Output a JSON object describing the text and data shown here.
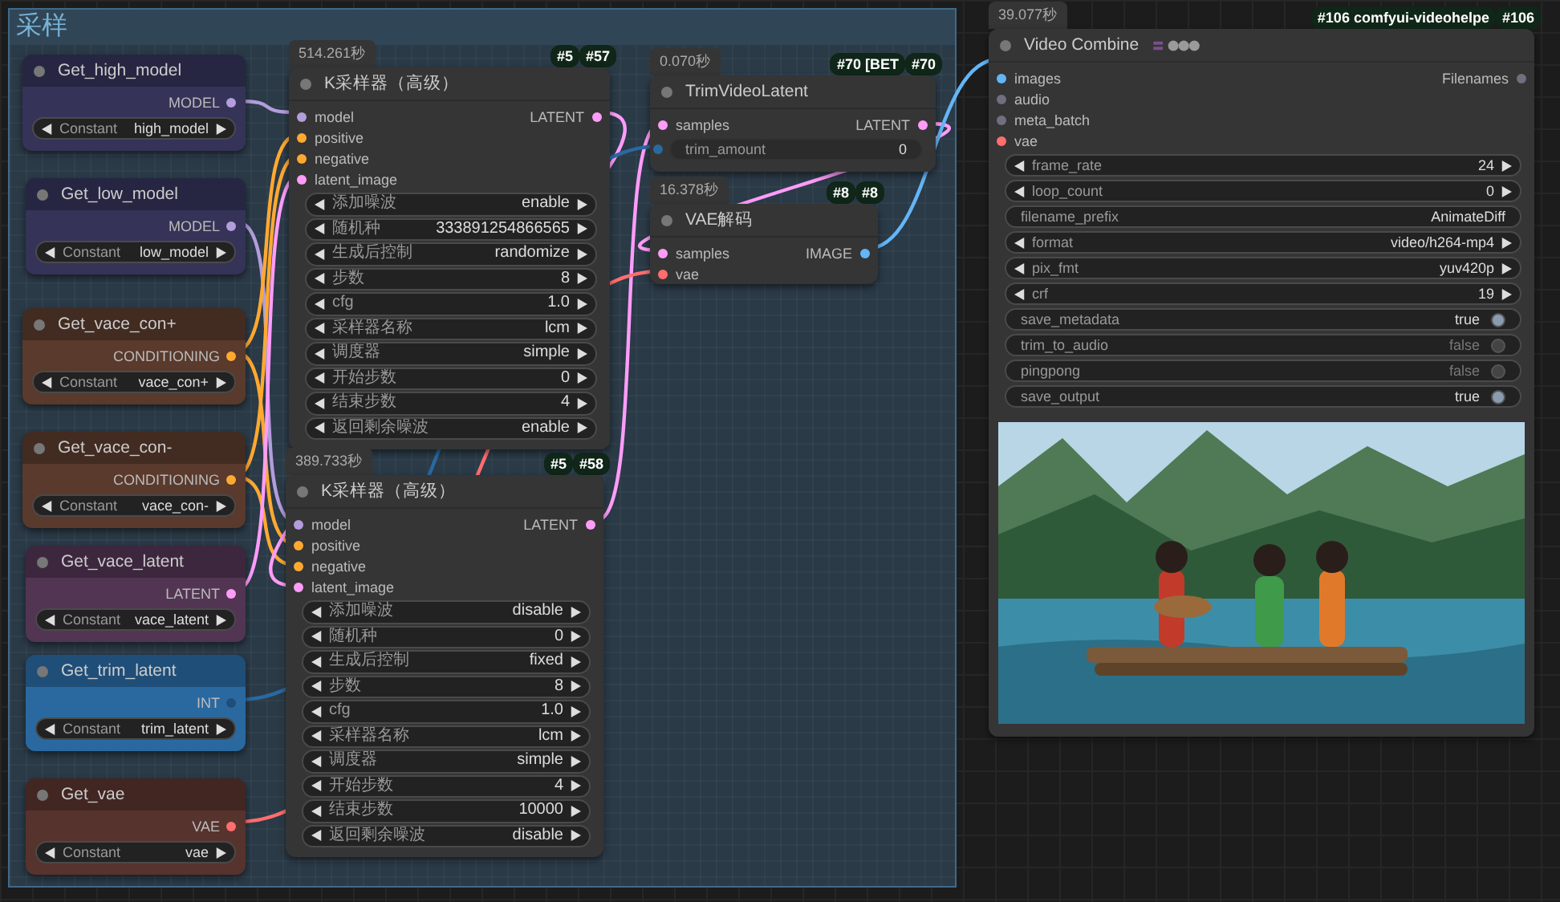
{
  "group": {
    "title": "采样"
  },
  "nodes": [
    {
      "kind": "getter",
      "title": "Get_high_model",
      "color": "#353358",
      "outputs": [
        {
          "label": "MODEL",
          "color": "#b39ddb"
        }
      ],
      "widgets": [
        {
          "kind": "combo",
          "label": "Constant",
          "value": "high_model"
        }
      ]
    },
    {
      "kind": "getter",
      "title": "Get_low_model",
      "color": "#353358",
      "outputs": [
        {
          "label": "MODEL",
          "color": "#b39ddb"
        }
      ],
      "widgets": [
        {
          "kind": "combo",
          "label": "Constant",
          "value": "low_model"
        }
      ]
    },
    {
      "kind": "getter",
      "title": "Get_vace_con+",
      "color": "#593a2c",
      "outputs": [
        {
          "label": "CONDITIONING",
          "color": "#ffa931"
        }
      ],
      "widgets": [
        {
          "kind": "combo",
          "label": "Constant",
          "value": "vace_con+"
        }
      ]
    },
    {
      "kind": "getter",
      "title": "Get_vace_con-",
      "color": "#593a2c",
      "outputs": [
        {
          "label": "CONDITIONING",
          "color": "#ffa931"
        }
      ],
      "widgets": [
        {
          "kind": "combo",
          "label": "Constant",
          "value": "vace_con-"
        }
      ]
    },
    {
      "kind": "getter",
      "title": "Get_vace_latent",
      "color": "#523553",
      "outputs": [
        {
          "label": "LATENT",
          "color": "#ff9cf9"
        }
      ],
      "widgets": [
        {
          "kind": "combo",
          "label": "Constant",
          "value": "vace_latent"
        }
      ]
    },
    {
      "kind": "getter",
      "title": "Get_trim_latent",
      "color": "#2a69a0",
      "outputs": [
        {
          "label": "INT",
          "color": "#1f4f78"
        }
      ],
      "widgets": [
        {
          "kind": "combo",
          "label": "Constant",
          "value": "trim_latent"
        }
      ]
    },
    {
      "kind": "getter",
      "title": "Get_vae",
      "color": "#57332e",
      "outputs": [
        {
          "label": "VAE",
          "color": "#ff6e6e"
        }
      ],
      "widgets": [
        {
          "kind": "combo",
          "label": "Constant",
          "value": "vae"
        }
      ]
    },
    {
      "kind": "sampler",
      "time": "514.261秒",
      "badges": [
        "#5",
        "#57"
      ],
      "title": "K采样器（高级）",
      "inputs": [
        {
          "label": "model",
          "color": "#b39ddb"
        },
        {
          "label": "positive",
          "color": "#ffa931"
        },
        {
          "label": "negative",
          "color": "#ffa931"
        },
        {
          "label": "latent_image",
          "color": "#ff9cf9"
        }
      ],
      "outputs": [
        {
          "label": "LATENT",
          "color": "#ff9cf9"
        }
      ],
      "widgets": [
        {
          "kind": "combo",
          "label": "添加噪波",
          "value": "enable"
        },
        {
          "kind": "number",
          "label": "随机种",
          "value": "333891254866565"
        },
        {
          "kind": "combo",
          "label": "生成后控制",
          "value": "randomize"
        },
        {
          "kind": "number",
          "label": "步数",
          "value": "8"
        },
        {
          "kind": "number",
          "label": "cfg",
          "value": "1.0"
        },
        {
          "kind": "combo",
          "label": "采样器名称",
          "value": "lcm"
        },
        {
          "kind": "combo",
          "label": "调度器",
          "value": "simple"
        },
        {
          "kind": "number",
          "label": "开始步数",
          "value": "0"
        },
        {
          "kind": "number",
          "label": "结束步数",
          "value": "4"
        },
        {
          "kind": "combo",
          "label": "返回剩余噪波",
          "value": "enable"
        }
      ]
    },
    {
      "kind": "sampler",
      "time": "389.733秒",
      "badges": [
        "#5",
        "#58"
      ],
      "title": "K采样器（高级）",
      "inputs": [
        {
          "label": "model",
          "color": "#b39ddb"
        },
        {
          "label": "positive",
          "color": "#ffa931"
        },
        {
          "label": "negative",
          "color": "#ffa931"
        },
        {
          "label": "latent_image",
          "color": "#ff9cf9"
        }
      ],
      "outputs": [
        {
          "label": "LATENT",
          "color": "#ff9cf9"
        }
      ],
      "widgets": [
        {
          "kind": "combo",
          "label": "添加噪波",
          "value": "disable"
        },
        {
          "kind": "number",
          "label": "随机种",
          "value": "0"
        },
        {
          "kind": "combo",
          "label": "生成后控制",
          "value": "fixed"
        },
        {
          "kind": "number",
          "label": "步数",
          "value": "8"
        },
        {
          "kind": "number",
          "label": "cfg",
          "value": "1.0"
        },
        {
          "kind": "combo",
          "label": "采样器名称",
          "value": "lcm"
        },
        {
          "kind": "combo",
          "label": "调度器",
          "value": "simple"
        },
        {
          "kind": "number",
          "label": "开始步数",
          "value": "4"
        },
        {
          "kind": "number",
          "label": "结束步数",
          "value": "10000"
        },
        {
          "kind": "combo",
          "label": "返回剩余噪波",
          "value": "disable"
        }
      ]
    },
    {
      "kind": "trim",
      "time": "0.070秒",
      "badges": [
        "#70 [BET",
        "#70"
      ],
      "title": "TrimVideoLatent",
      "inputs": [
        {
          "label": "samples",
          "color": "#ff9cf9"
        }
      ],
      "outputs": [
        {
          "label": "LATENT",
          "color": "#ff9cf9"
        }
      ],
      "widgets": [
        {
          "kind": "linked",
          "label": "trim_amount",
          "value": "0",
          "color": "#2a69a0"
        }
      ]
    },
    {
      "kind": "vae",
      "time": "16.378秒",
      "badges": [
        "#8",
        "#8"
      ],
      "title": "VAE解码",
      "inputs": [
        {
          "label": "samples",
          "color": "#ff9cf9"
        },
        {
          "label": "vae",
          "color": "#ff6e6e"
        }
      ],
      "outputs": [
        {
          "label": "IMAGE",
          "color": "#64b5f6"
        }
      ]
    },
    {
      "kind": "video",
      "time": "39.077秒",
      "badges": [
        "#106 comfyui-videohelpe",
        "#106"
      ],
      "title": "Video Combine",
      "inputs": [
        {
          "label": "images",
          "color": "#64b5f6"
        },
        {
          "label": "audio",
          "color": "#6f6f80"
        },
        {
          "label": "meta_batch",
          "color": "#6f6f80"
        },
        {
          "label": "vae",
          "color": "#ff6e6e"
        }
      ],
      "outputs": [
        {
          "label": "Filenames",
          "color": "#6f6f80"
        }
      ],
      "widgets": [
        {
          "kind": "number",
          "label": "frame_rate",
          "value": "24"
        },
        {
          "kind": "number",
          "label": "loop_count",
          "value": "0"
        },
        {
          "kind": "text",
          "label": "filename_prefix",
          "value": "AnimateDiff"
        },
        {
          "kind": "combo",
          "label": "format",
          "value": "video/h264-mp4"
        },
        {
          "kind": "combo",
          "label": "pix_fmt",
          "value": "yuv420p"
        },
        {
          "kind": "number",
          "label": "crf",
          "value": "19"
        },
        {
          "kind": "toggle",
          "label": "save_metadata",
          "value": "true",
          "on": true
        },
        {
          "kind": "toggle",
          "label": "trim_to_audio",
          "value": "false",
          "on": false
        },
        {
          "kind": "toggle",
          "label": "pingpong",
          "value": "false",
          "on": false
        },
        {
          "kind": "toggle",
          "label": "save_output",
          "value": "true",
          "on": true
        }
      ],
      "preview": {
        "kind": "picture"
      }
    }
  ]
}
